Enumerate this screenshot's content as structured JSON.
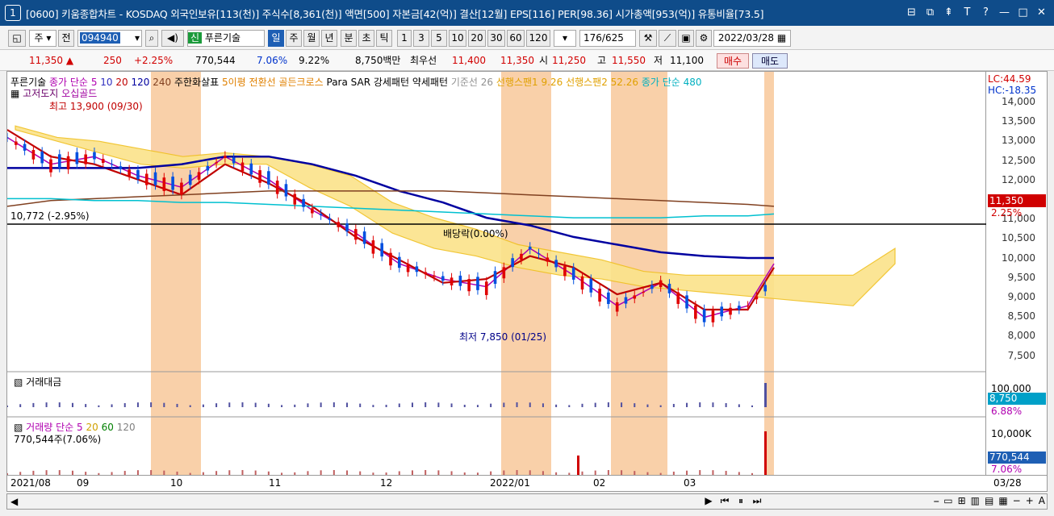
{
  "title": {
    "window_num": "1",
    "text": "[0600] 키움종합차트 - KOSDAQ 외국인보유[113(천)] 주식수[8,361(천)] 액면[500] 자본금[42(억)] 결산[12월] EPS[116] PER[98.36] 시가총액[953(억)] 유통비율[73.5]",
    "controls": [
      "⊟",
      "⧉",
      "⇞",
      "T",
      "?",
      "—",
      "□",
      "✕"
    ]
  },
  "toolbar": {
    "market": "주",
    "prev": "전",
    "code": "094940",
    "badge": "신",
    "stock_name": "푸른기술",
    "periods": [
      "일",
      "주",
      "월",
      "년",
      "분",
      "초",
      "틱"
    ],
    "active_period": "일",
    "intervals": [
      "1",
      "3",
      "5",
      "10",
      "20",
      "30",
      "60",
      "120"
    ],
    "count": "176",
    "total": "/625",
    "date": "2022/03/28"
  },
  "pricebar": {
    "price": "11,350",
    "change": "250",
    "change_pct": "+2.25%",
    "volume": "770,544",
    "vol_ratio": "7.06%",
    "turnover": "9.22%",
    "amount": "8,750백만",
    "best_label": "최우선",
    "best_ask": "11,400",
    "best_bid": "11,350",
    "open_label": "시",
    "open": "11,250",
    "high_label": "고",
    "high": "11,550",
    "low_label": "저",
    "low": "11,100",
    "buy": "매수",
    "sell": "매도"
  },
  "legend": {
    "name": "푸른기술",
    "ma_label": "종가 단순",
    "ma": [
      "5",
      "10",
      "20",
      "120",
      "240"
    ],
    "ma_colors": [
      "#b000b0",
      "#3030c0",
      "#c00000",
      "#0000a0",
      "#804020"
    ],
    "signal1": "주한화살표",
    "signal2": "5이평 전환선 골든크로스",
    "signal3": "Para SAR 강세패턴",
    "signal4": "약세패턴",
    "base": "기준선 26",
    "span1": "선행스팬1 9.26",
    "span2": "선행스팬2 52.26",
    "ma480": "종가 단순 480",
    "doji": "고저도지",
    "osama": "오십골드",
    "lc": "LC:44.59",
    "hc": "HC:-18.35"
  },
  "annotations": {
    "high": "최고 13,900 (09/30)",
    "low": "최저 7,850 (01/25)",
    "dividend": "배당락(0.00%)",
    "hline": "10,772 (-2.95%)"
  },
  "yaxis": {
    "ticks": [
      "14,000",
      "13,500",
      "13,000",
      "12,500",
      "12,000",
      "11,500",
      "11,000",
      "10,500",
      "10,000",
      "9,500",
      "9,000",
      "8,500",
      "8,000",
      "7,500"
    ],
    "price_tag": "11,350",
    "pct_tag": "2.25%"
  },
  "panels": {
    "amount_label": "거래대금",
    "amount_tick": "100,000",
    "amount_tag": "8,750",
    "amount_pct": "6.88%",
    "volume_label": "거래량",
    "volume_ma": "단순",
    "volume_ma_vals": [
      "5",
      "20",
      "60",
      "120"
    ],
    "volume_value": "770,544주(7.06%)",
    "volume_tick": "10,000K",
    "volume_tag": "770,544",
    "volume_pct": "7.06%"
  },
  "xaxis": {
    "labels": [
      "2021/08",
      "09",
      "10",
      "11",
      "12",
      "2022/01",
      "02",
      "03"
    ],
    "right": "03/28"
  },
  "chart_data": {
    "type": "line",
    "title": "",
    "xlabel": "",
    "ylabel": "",
    "ylim": [
      7400,
      14100
    ],
    "x": [
      0,
      10,
      20,
      30,
      40,
      50,
      60,
      70,
      80,
      90,
      100,
      110,
      120,
      130,
      140,
      150,
      160,
      170,
      176
    ],
    "series": [
      {
        "name": "5",
        "values": [
          13100,
          12400,
          12600,
          12100,
          11800,
          12600,
          12000,
          11200,
          10600,
          9800,
          9400,
          9200,
          10200,
          9500,
          8700,
          9300,
          8400,
          8700,
          9800
        ]
      },
      {
        "name": "20",
        "values": [
          13300,
          12600,
          12400,
          12000,
          11600,
          12400,
          11900,
          11300,
          10500,
          9900,
          9300,
          9400,
          10000,
          9700,
          9000,
          9300,
          8600,
          8600,
          9700
        ]
      },
      {
        "name": "120",
        "values": [
          12300,
          12300,
          12300,
          12300,
          12400,
          12600,
          12600,
          12400,
          12100,
          11700,
          11400,
          11000,
          10800,
          10500,
          10300,
          10100,
          10000,
          9950,
          9950
        ]
      },
      {
        "name": "240",
        "values": [
          11300,
          11450,
          11500,
          11550,
          11600,
          11650,
          11700,
          11700,
          11700,
          11700,
          11700,
          11650,
          11600,
          11550,
          11500,
          11450,
          11400,
          11350,
          11300
        ]
      },
      {
        "name": "종가 단순 480",
        "values": [
          11500,
          11500,
          11450,
          11450,
          11400,
          11400,
          11350,
          11300,
          11250,
          11200,
          11150,
          11100,
          11050,
          11000,
          11000,
          11000,
          11050,
          11050,
          11100
        ]
      }
    ]
  },
  "colors": {
    "up": "#e00000",
    "down": "#0050e0",
    "highlight": "#f8c89a",
    "cloud": "#f0c020",
    "title_bg": "#0f4c8a"
  }
}
